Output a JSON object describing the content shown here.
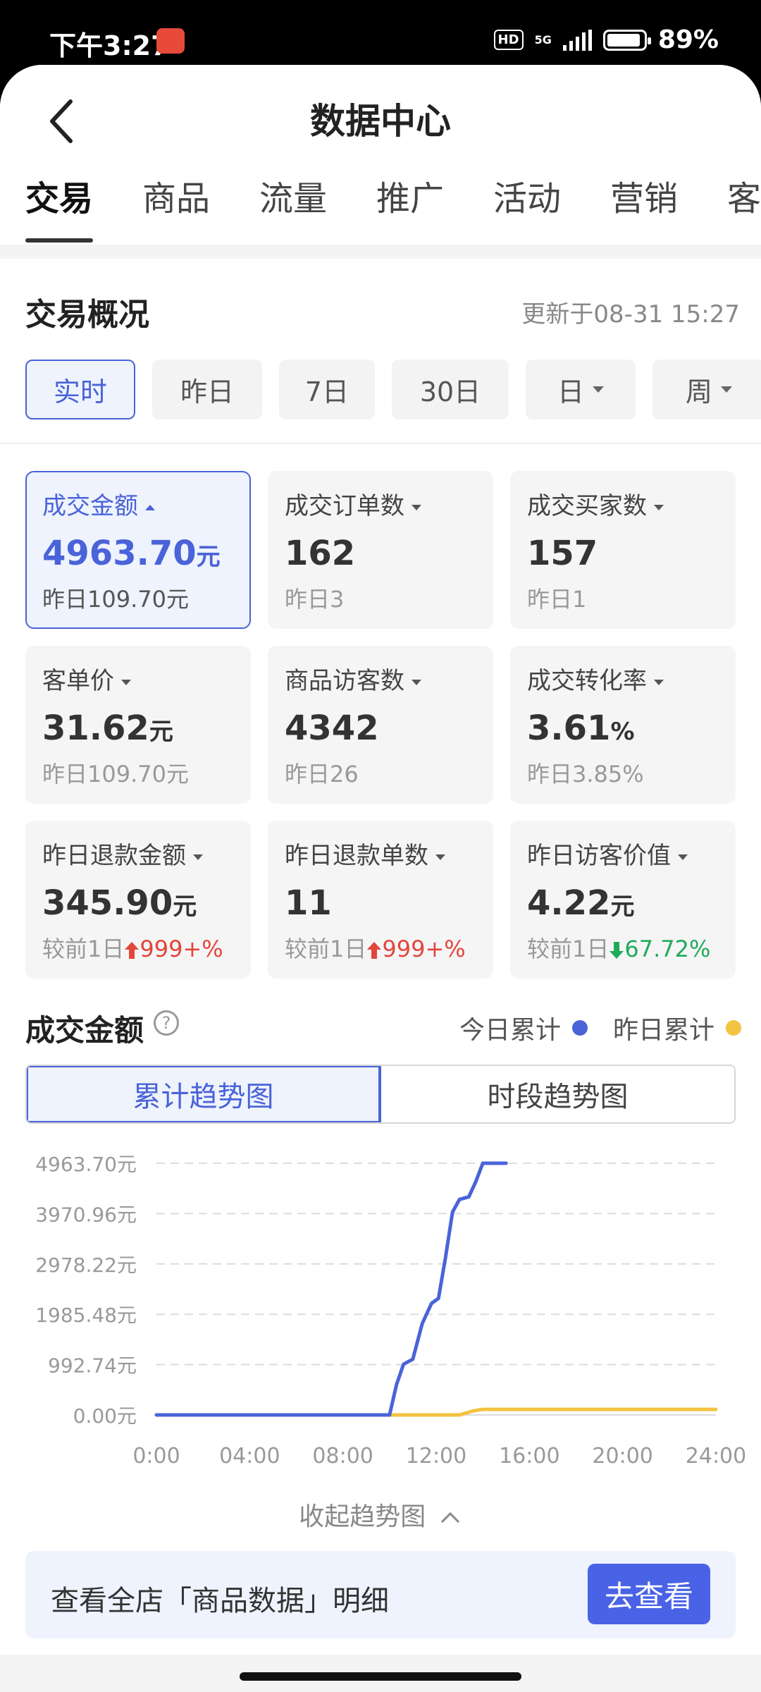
{
  "status_bar": {
    "time": "下午3:27",
    "hd": "HD",
    "network": "5G",
    "battery": "89%",
    "battery_level": 0.89
  },
  "header": {
    "title": "数据中心"
  },
  "tabs": [
    {
      "label": "交易",
      "active": true
    },
    {
      "label": "商品"
    },
    {
      "label": "流量"
    },
    {
      "label": "推广"
    },
    {
      "label": "活动"
    },
    {
      "label": "营销"
    },
    {
      "label": "客"
    }
  ],
  "overview": {
    "title": "交易概况",
    "updated": "更新于08-31 15:27",
    "periods": [
      {
        "label": "实时",
        "active": true
      },
      {
        "label": "昨日"
      },
      {
        "label": "7日"
      },
      {
        "label": "30日"
      },
      {
        "label": "日",
        "dropdown": true
      },
      {
        "label": "周",
        "dropdown": true
      }
    ]
  },
  "metrics": [
    {
      "label": "成交金额",
      "value": "4963.70",
      "unit": "元",
      "sub": "昨日109.70元",
      "active": true
    },
    {
      "label": "成交订单数",
      "value": "162",
      "unit": "",
      "sub": "昨日3"
    },
    {
      "label": "成交买家数",
      "value": "157",
      "unit": "",
      "sub": "昨日1"
    },
    {
      "label": "客单价",
      "value": "31.62",
      "unit": "元",
      "sub": "昨日109.70元"
    },
    {
      "label": "商品访客数",
      "value": "4342",
      "unit": "",
      "sub": "昨日26"
    },
    {
      "label": "成交转化率",
      "value": "3.61",
      "unit": "%",
      "sub": "昨日3.85%"
    },
    {
      "label": "昨日退款金额",
      "value": "345.90",
      "unit": "元",
      "sub_prefix": "较前1日",
      "change": "999+%",
      "direction": "up"
    },
    {
      "label": "昨日退款单数",
      "value": "11",
      "unit": "",
      "sub_prefix": "较前1日",
      "change": "999+%",
      "direction": "up"
    },
    {
      "label": "昨日访客价值",
      "value": "4.22",
      "unit": "元",
      "sub_prefix": "较前1日",
      "change": "67.72%",
      "direction": "down"
    }
  ],
  "trend": {
    "title": "成交金额",
    "legend_today": "今日累计",
    "legend_yesterday": "昨日累计",
    "mode_cumulative": "累计趋势图",
    "mode_period": "时段趋势图",
    "collapse": "收起趋势图",
    "colors": {
      "today": "#4a63d8",
      "yesterday": "#f5c342",
      "up": "#e4453b",
      "down": "#1fab5a",
      "accent": "#4a63d8"
    }
  },
  "chart_data": {
    "type": "line",
    "x_ticks": [
      "0:00",
      "04:00",
      "08:00",
      "12:00",
      "16:00",
      "20:00",
      "24:00"
    ],
    "y_ticks": [
      "0.00元",
      "992.74元",
      "1985.48元",
      "2978.22元",
      "3970.96元",
      "4963.70元"
    ],
    "ylim": [
      0,
      4963.7
    ],
    "xlim": [
      0,
      24
    ],
    "grid": true,
    "series": [
      {
        "name": "今日累计",
        "color": "#4a63d8",
        "points": [
          [
            0,
            0
          ],
          [
            6,
            0
          ],
          [
            10,
            0
          ],
          [
            10.3,
            600
          ],
          [
            10.6,
            1000
          ],
          [
            11,
            1100
          ],
          [
            11.4,
            1800
          ],
          [
            11.8,
            2200
          ],
          [
            12.1,
            2300
          ],
          [
            12.4,
            3100
          ],
          [
            12.7,
            4000
          ],
          [
            13,
            4250
          ],
          [
            13.4,
            4300
          ],
          [
            13.7,
            4600
          ],
          [
            14,
            4963.7
          ],
          [
            15,
            4963.7
          ]
        ]
      },
      {
        "name": "昨日累计",
        "color": "#f5c342",
        "points": [
          [
            0,
            0
          ],
          [
            13,
            0
          ],
          [
            13.6,
            80
          ],
          [
            14,
            109.7
          ],
          [
            24,
            109.7
          ]
        ]
      }
    ]
  },
  "banner": {
    "text": "查看全店「商品数据」明细",
    "button": "去查看"
  }
}
